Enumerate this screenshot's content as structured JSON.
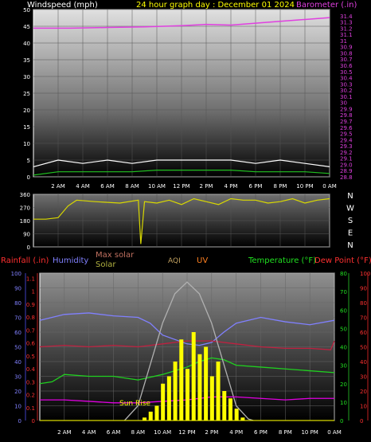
{
  "chart_data": [
    {
      "type": "line",
      "title": "24 hour graph day : December 01 2024",
      "ylabel": "Windspeed (mph)",
      "y2label": "Barometer (.in)",
      "ylim": [
        0,
        50
      ],
      "y2lim": [
        28.8,
        31.5
      ],
      "yticks": [
        "0",
        "5",
        "10",
        "15",
        "20",
        "25",
        "30",
        "35",
        "40",
        "45",
        "50"
      ],
      "y2ticks": [
        "28.8",
        "28.9",
        "29.0",
        "29.1",
        "29.2",
        "29.3",
        "29.4",
        "29.5",
        "29.6",
        "29.7",
        "29.8",
        "29.9",
        "30",
        "30.1",
        "30.2",
        "30.3",
        "30.4",
        "30.5",
        "30.6",
        "30.7",
        "30.8",
        "30.9",
        "31",
        "31.1",
        "31.2",
        "31.3",
        "31.4"
      ],
      "xticks": [
        "2 AM",
        "4 AM",
        "6 AM",
        "8 AM",
        "10 AM",
        "12 PM",
        "2 PM",
        "4 PM",
        "6 PM",
        "8 PM",
        "10 PM",
        "0 AM"
      ],
      "series": [
        {
          "key": "barometer",
          "color": "#e040e0",
          "x": [
            0,
            3,
            6,
            9,
            12,
            14,
            16,
            18,
            20,
            22,
            24
          ],
          "y": [
            31.2,
            31.2,
            31.21,
            31.22,
            31.24,
            31.26,
            31.25,
            31.28,
            31.31,
            31.34,
            31.37
          ]
        },
        {
          "key": "gust",
          "color": "#ffffff",
          "x": [
            0,
            2,
            4,
            6,
            8,
            10,
            12,
            14,
            16,
            18,
            20,
            22,
            24
          ],
          "y": [
            3,
            5,
            4,
            5,
            4,
            5,
            5,
            5,
            5,
            4,
            5,
            4,
            3
          ]
        },
        {
          "key": "wind",
          "color": "#20c020",
          "x": [
            0,
            2,
            4,
            6,
            8,
            10,
            12,
            14,
            16,
            18,
            20,
            22,
            24
          ],
          "y": [
            0.5,
            1.5,
            1.5,
            1.5,
            1.5,
            2,
            2,
            2,
            2,
            1.5,
            1.5,
            1.5,
            1
          ]
        }
      ]
    },
    {
      "type": "line",
      "ylim": [
        0,
        360
      ],
      "yticks": [
        "0",
        "90",
        "180",
        "270",
        "360"
      ],
      "direction_labels": [
        "N",
        "W",
        "S",
        "E",
        "N"
      ],
      "xticks": [
        "2 AM",
        "4 AM",
        "6 AM",
        "8 AM",
        "10 AM",
        "12 PM",
        "2 PM",
        "4 PM",
        "6 PM",
        "8 PM",
        "10 PM",
        "0 AM"
      ],
      "series": [
        {
          "key": "direction",
          "color": "#d8d800",
          "x": [
            0,
            1,
            2,
            2.8,
            3.5,
            5,
            7,
            8.5,
            8.7,
            9,
            10,
            11,
            12,
            13,
            14,
            15,
            16,
            17,
            18,
            19,
            20,
            21,
            22,
            23,
            24
          ],
          "y": [
            190,
            190,
            200,
            280,
            320,
            310,
            300,
            320,
            20,
            310,
            300,
            320,
            290,
            330,
            310,
            290,
            330,
            320,
            320,
            300,
            310,
            330,
            300,
            320,
            330
          ]
        }
      ]
    },
    {
      "type": "line",
      "labels": {
        "rainfall": "Rainfall (.in)",
        "humidity": "Humidity",
        "maxsolar": "Max solar",
        "solar": "Solar",
        "aqi": "AQI",
        "uv": "UV",
        "temperature": "Temperature (°F)",
        "dewpoint": "Dew Point (°F)",
        "sunrise": "Sun Rise"
      },
      "rain_ticks": [
        "0",
        "0.1",
        "0.2",
        "0.3",
        "0.4",
        "0.5",
        "0.6",
        "0.7",
        "0.8",
        "0.9",
        "1",
        "1.1"
      ],
      "humidity_ticks": [
        "0",
        "10",
        "20",
        "30",
        "40",
        "50",
        "60",
        "70",
        "80",
        "90",
        "100"
      ],
      "temp_ticks": [
        "0",
        "10",
        "20",
        "30",
        "40",
        "50",
        "60",
        "70",
        "80"
      ],
      "uv_ticks": [
        "0",
        "10",
        "20",
        "30",
        "40",
        "50",
        "60",
        "70",
        "80",
        "90",
        "100"
      ],
      "xticks": [
        "2 AM",
        "4 AM",
        "6 AM",
        "8 AM",
        "10 AM",
        "12 PM",
        "2 PM",
        "4 PM",
        "6 PM",
        "8 PM",
        "10 PM",
        "0 AM"
      ],
      "ylim_humidity": [
        0,
        100
      ],
      "ylim_temp": [
        0,
        80
      ],
      "series": [
        {
          "key": "humidity",
          "color": "#8080ff",
          "x": [
            0,
            2,
            4,
            6,
            8,
            9,
            10,
            12,
            13,
            14,
            15,
            16,
            18,
            20,
            22,
            24
          ],
          "y": [
            68,
            72,
            73,
            71,
            70,
            66,
            58,
            52,
            51,
            53,
            60,
            66,
            70,
            67,
            65,
            68
          ]
        },
        {
          "key": "dewpoint",
          "color": "#c02040",
          "x": [
            0,
            2,
            4,
            6,
            8,
            10,
            12,
            14,
            16,
            18,
            20,
            22,
            23.7,
            24
          ],
          "y": [
            50,
            51,
            50,
            51,
            50,
            52,
            54,
            54,
            52,
            50,
            49,
            49,
            48,
            54
          ]
        },
        {
          "key": "temperature",
          "color": "#20d020",
          "x": [
            0,
            1,
            2,
            4,
            6,
            8,
            10,
            12,
            13,
            14,
            15,
            16,
            18,
            20,
            22,
            24
          ],
          "y": [
            20,
            21,
            25,
            24,
            24,
            22,
            25,
            29,
            32,
            34,
            33,
            30,
            29,
            28,
            27,
            26
          ]
        },
        {
          "key": "maxsolar",
          "color": "#b0b0b0",
          "x": [
            6.9,
            8,
            9,
            10,
            11,
            12,
            13,
            14,
            15,
            16,
            17,
            17.4
          ],
          "y": [
            0,
            10,
            38,
            66,
            86,
            94,
            86,
            66,
            38,
            10,
            1,
            0
          ]
        },
        {
          "key": "aqi",
          "color": "#e000e0",
          "x": [
            0,
            2,
            4,
            6,
            8,
            10,
            12,
            14,
            16,
            18,
            20,
            22,
            24
          ],
          "y": [
            14,
            14,
            13,
            12,
            12,
            13,
            14,
            16,
            16,
            15,
            14,
            15,
            15
          ]
        },
        {
          "key": "rain",
          "color": "#d8d800",
          "x": [
            0,
            1,
            2,
            3,
            4,
            6,
            8,
            10,
            12,
            14,
            16,
            18,
            20,
            22,
            24
          ],
          "y": [
            0,
            0,
            0,
            0,
            0,
            0,
            0,
            0,
            0,
            0,
            0,
            0,
            0,
            0,
            0
          ]
        },
        {
          "key": "solar",
          "color": "#ffff00",
          "x": [
            8.5,
            9,
            9.5,
            10,
            10.5,
            11,
            11.5,
            12,
            12.5,
            13,
            13.5,
            14,
            14.5,
            15,
            15.5,
            16,
            16.5
          ],
          "y": [
            2,
            6,
            10,
            25,
            30,
            40,
            55,
            35,
            60,
            45,
            50,
            30,
            40,
            20,
            15,
            8,
            2
          ]
        }
      ]
    }
  ]
}
